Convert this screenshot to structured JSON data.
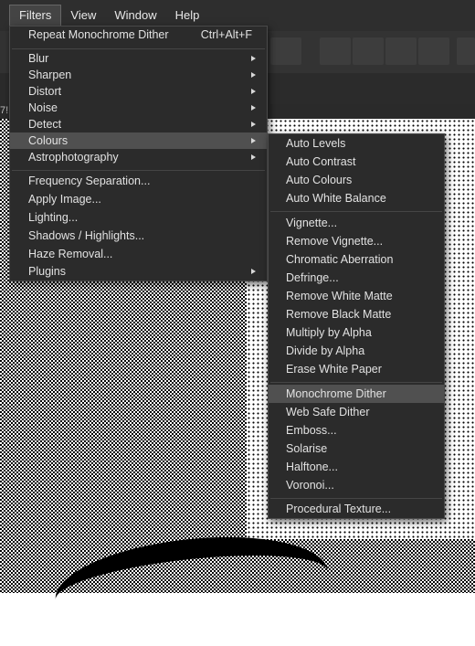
{
  "menubar": {
    "items": [
      {
        "label": "Filters"
      },
      {
        "label": "View"
      },
      {
        "label": "Window"
      },
      {
        "label": "Help"
      }
    ]
  },
  "doc_tab_fragment": "7!",
  "filters_menu": {
    "repeat": {
      "label": "Repeat Monochrome Dither",
      "shortcut": "Ctrl+Alt+F"
    },
    "group1": [
      "Blur",
      "Sharpen",
      "Distort",
      "Noise",
      "Detect",
      "Colours",
      "Astrophotography"
    ],
    "group2": [
      "Frequency Separation...",
      "Apply Image...",
      "Lighting...",
      "Shadows / Highlights...",
      "Haze Removal...",
      "Plugins"
    ],
    "highlighted": "Colours"
  },
  "colours_menu": {
    "group1": [
      "Auto Levels",
      "Auto Contrast",
      "Auto Colours",
      "Auto White Balance"
    ],
    "group2": [
      "Vignette...",
      "Remove Vignette...",
      "Chromatic Aberration",
      "Defringe...",
      "Remove White Matte",
      "Remove Black Matte",
      "Multiply by Alpha",
      "Divide by Alpha",
      "Erase White Paper"
    ],
    "group3": [
      "Monochrome Dither",
      "Web Safe Dither",
      "Emboss...",
      "Solarise",
      "Halftone...",
      "Voronoi..."
    ],
    "group4": [
      "Procedural Texture..."
    ],
    "highlighted": "Monochrome Dither"
  },
  "colors": {
    "menu_bg": "#2b2b2b",
    "highlight": "#505050",
    "text": "#e2e2e2"
  }
}
